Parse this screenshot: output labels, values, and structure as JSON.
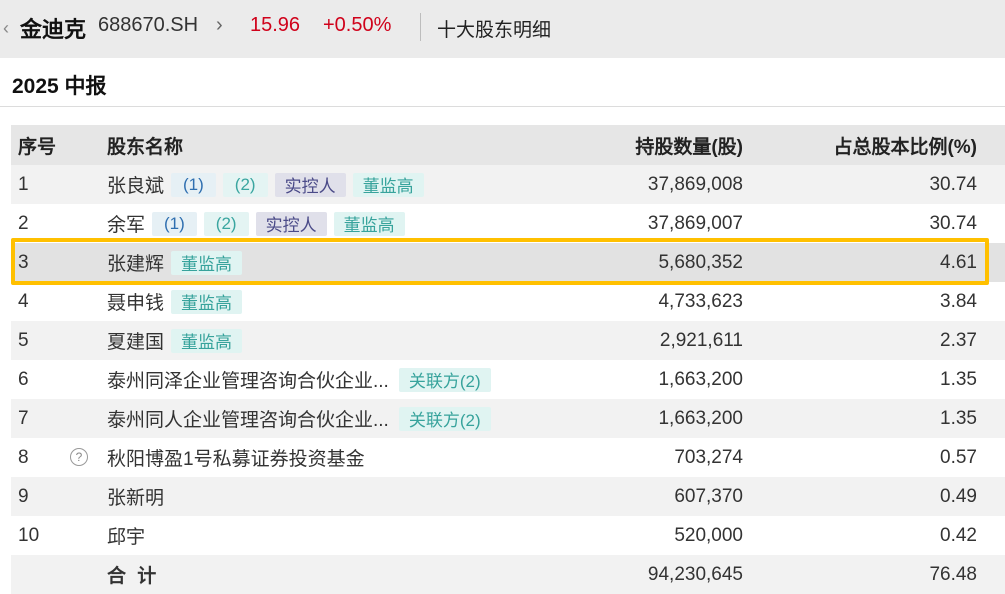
{
  "header": {
    "back_icon": "‹",
    "stock_name": "金迪克",
    "stock_code": "688670.SH",
    "nav_chevron": "›",
    "price": "15.96",
    "change_pct": "+0.50%",
    "page_title": "十大股东明细",
    "price_color": "#d0021b"
  },
  "period_title": "2025 中报",
  "table": {
    "columns": [
      "序号",
      "股东名称",
      "持股数量(股)",
      "占总股本比例(%)"
    ],
    "rows": [
      {
        "idx": "1",
        "name": "张良斌",
        "tags": [
          "(1)",
          "(2)",
          "实控人",
          "董监高"
        ],
        "shares": "37,869,008",
        "ratio": "30.74"
      },
      {
        "idx": "2",
        "name": "余军",
        "tags": [
          "(1)",
          "(2)",
          "实控人",
          "董监高"
        ],
        "shares": "37,869,007",
        "ratio": "30.74"
      },
      {
        "idx": "3",
        "name": "张建辉",
        "tags": [
          "董监高"
        ],
        "shares": "5,680,352",
        "ratio": "4.61"
      },
      {
        "idx": "4",
        "name": "聂申钱",
        "tags": [
          "董监高"
        ],
        "shares": "4,733,623",
        "ratio": "3.84"
      },
      {
        "idx": "5",
        "name": "夏建国",
        "tags": [
          "董监高"
        ],
        "shares": "2,921,611",
        "ratio": "2.37"
      },
      {
        "idx": "6",
        "name": "泰州同泽企业管理咨询合伙企业...",
        "tags": [
          "关联方(2)"
        ],
        "shares": "1,663,200",
        "ratio": "1.35"
      },
      {
        "idx": "7",
        "name": "泰州同人企业管理咨询合伙企业...",
        "tags": [
          "关联方(2)"
        ],
        "shares": "1,663,200",
        "ratio": "1.35"
      },
      {
        "idx": "8",
        "name": "秋阳博盈1号私募证券投资基金",
        "help_icon": "?",
        "tags": [],
        "shares": "703,274",
        "ratio": "0.57"
      },
      {
        "idx": "9",
        "name": "张新明",
        "tags": [],
        "shares": "607,370",
        "ratio": "0.49"
      },
      {
        "idx": "10",
        "name": "邱宇",
        "tags": [],
        "shares": "520,000",
        "ratio": "0.42"
      }
    ],
    "total": {
      "label": "合 计",
      "shares": "94,230,645",
      "ratio": "76.48"
    }
  },
  "highlight_color": "#ffc000"
}
